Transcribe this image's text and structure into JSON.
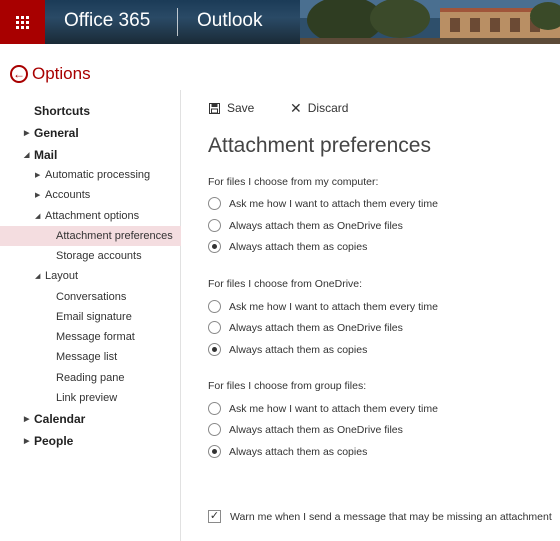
{
  "header": {
    "brand": "Office 365",
    "app": "Outlook"
  },
  "options_title": "Options",
  "sidebar": {
    "items": [
      {
        "label": "Shortcuts"
      },
      {
        "label": "General"
      },
      {
        "label": "Mail"
      },
      {
        "label": "Automatic processing"
      },
      {
        "label": "Accounts"
      },
      {
        "label": "Attachment options"
      },
      {
        "label": "Attachment preferences"
      },
      {
        "label": "Storage accounts"
      },
      {
        "label": "Layout"
      },
      {
        "label": "Conversations"
      },
      {
        "label": "Email signature"
      },
      {
        "label": "Message format"
      },
      {
        "label": "Message list"
      },
      {
        "label": "Reading pane"
      },
      {
        "label": "Link preview"
      },
      {
        "label": "Calendar"
      },
      {
        "label": "People"
      }
    ]
  },
  "toolbar": {
    "save_label": "Save",
    "discard_label": "Discard"
  },
  "page_title": "Attachment preferences",
  "sections": [
    {
      "label": "For files I choose from my computer:",
      "options": [
        "Ask me how I want to attach them every time",
        "Always attach them as OneDrive files",
        "Always attach them as copies"
      ],
      "selected": 2
    },
    {
      "label": "For files I choose from OneDrive:",
      "options": [
        "Ask me how I want to attach them every time",
        "Always attach them as OneDrive files",
        "Always attach them as copies"
      ],
      "selected": 2
    },
    {
      "label": "For files I choose from group files:",
      "options": [
        "Ask me how I want to attach them every time",
        "Always attach them as OneDrive files",
        "Always attach them as copies"
      ],
      "selected": 2
    }
  ],
  "warn_checkbox": {
    "label": "Warn me when I send a message that may be missing an attachment",
    "checked": true
  },
  "colors": {
    "accent": "#a80000",
    "selected_bg": "#f4dde0"
  }
}
